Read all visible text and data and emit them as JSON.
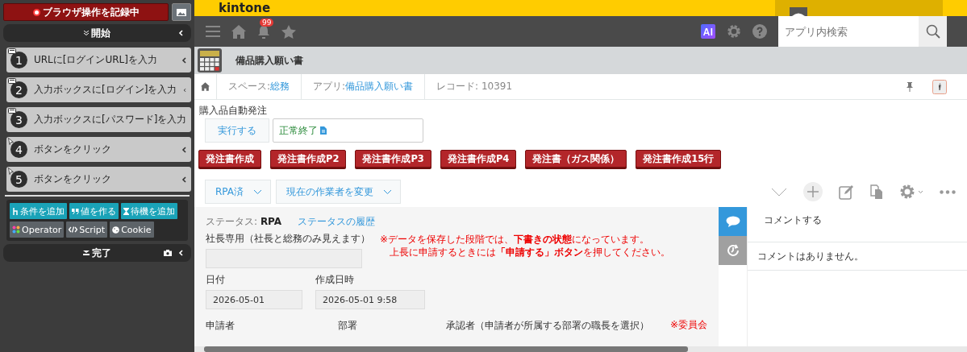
{
  "recorder": {
    "record_label": "ブラウザ操作を記録中",
    "start_label": "開始",
    "steps": [
      {
        "number": "1",
        "label": "URLに[ログインURL]を入力",
        "kind": "input"
      },
      {
        "number": "2",
        "label": "入力ボックスに[ログイン]を入力",
        "kind": "input"
      },
      {
        "number": "3",
        "label": "入力ボックスに[パスワード]を入力",
        "kind": "input"
      },
      {
        "number": "4",
        "label": "ボタンをクリック",
        "kind": "click"
      },
      {
        "number": "5",
        "label": "ボタンをクリック",
        "kind": "click"
      }
    ],
    "tools": [
      {
        "label": "条件を追加",
        "kind": "condition"
      },
      {
        "label": "値を作る",
        "kind": "value"
      },
      {
        "label": "待機を追加",
        "kind": "wait"
      },
      {
        "label": "Operator",
        "kind": "operator"
      },
      {
        "label": "Script",
        "kind": "script"
      },
      {
        "label": "Cookie",
        "kind": "cookie"
      }
    ],
    "end_label": "完了"
  },
  "header": {
    "logo": "kintone",
    "notification_count": "99",
    "search_placeholder": "アプリ内検索"
  },
  "app": {
    "title": "備品購入願い書"
  },
  "breadcrumb": [
    {
      "prefix": "スペース: ",
      "link": "総務"
    },
    {
      "prefix": "アプリ: ",
      "link": "備品購入願い書"
    },
    {
      "prefix": "レコード: 10391"
    }
  ],
  "process": {
    "label": "購入品自動発注",
    "run_button": "実行する",
    "result": "正常終了"
  },
  "buttons": [
    "発注書作成",
    "発注書作成P2",
    "発注書作成P3",
    "発注書作成P4",
    "発注書（ガス関係）",
    "発注書作成15行"
  ],
  "dropdowns": [
    "RPA済",
    "現在の作業者を変更"
  ],
  "status": {
    "label": "ステータス:",
    "value": "RPA",
    "history": "ステータスの履歴"
  },
  "private_field": {
    "label": "社長専用（社長と総務のみ見えます）"
  },
  "notice": [
    "※データを保存した段階では、**下書きの状態**になっています。",
    "上長に申請するときには**「申請する」ボタン**を押してください。"
  ],
  "date_fields": [
    {
      "label": "日付",
      "value": "2026-05-01"
    },
    {
      "label": "作成日時",
      "value": "2026-05-01 9:58"
    }
  ],
  "next_labels": [
    "申請者",
    "部署",
    "承認者（申請者が所属する部署の職長を選択）"
  ],
  "next_note": "※委員会",
  "side_tabs": [
    {
      "kind": "comment",
      "selected": true
    },
    {
      "kind": "history",
      "selected": false
    }
  ],
  "comments": {
    "placeholder": "コメントする",
    "empty": "コメントはありません。"
  }
}
